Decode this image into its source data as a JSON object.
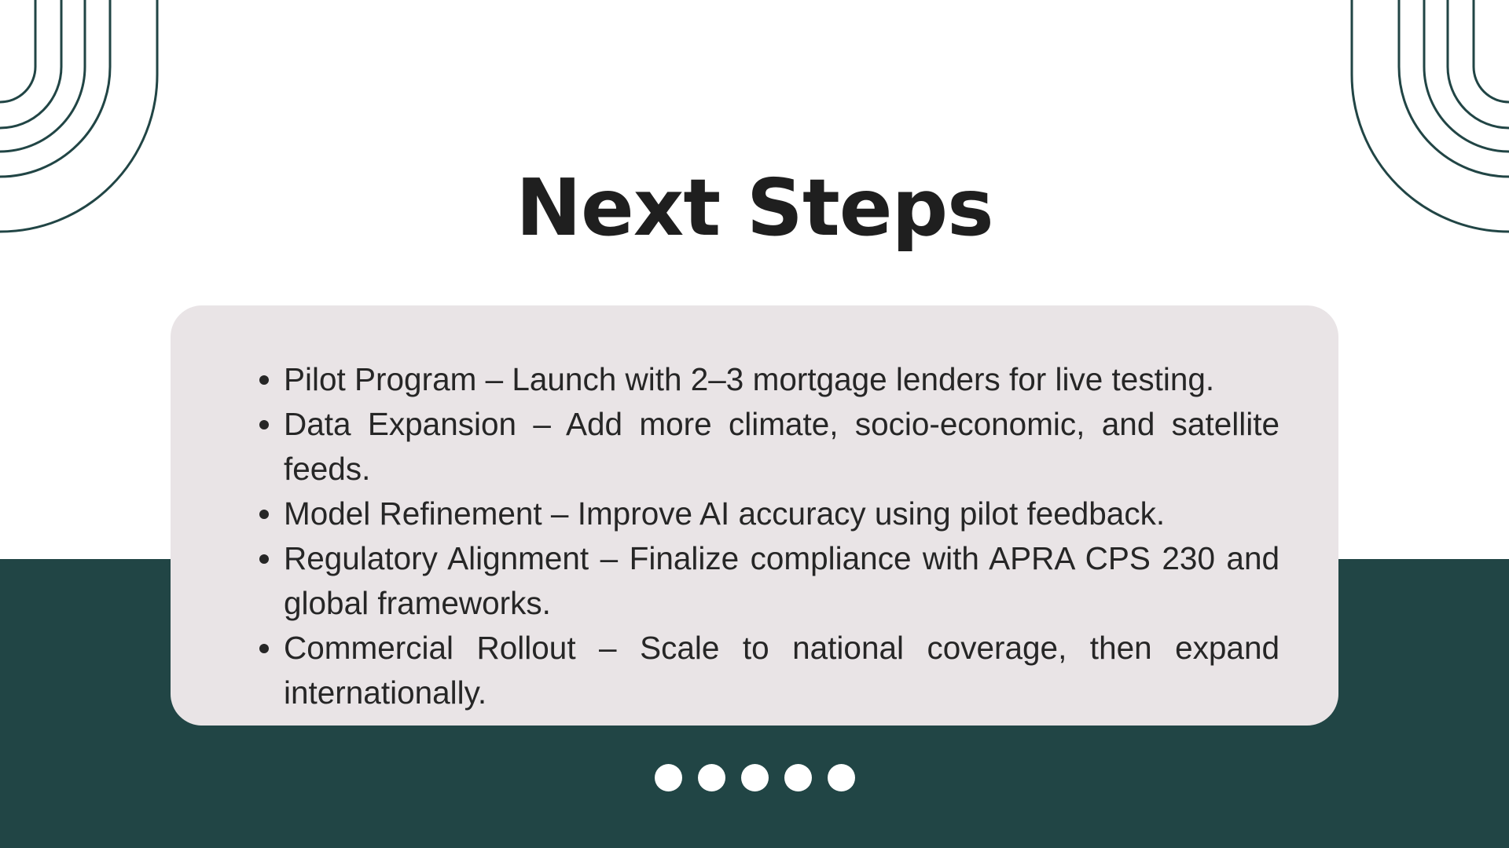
{
  "slide": {
    "title": "Next Steps",
    "steps": [
      {
        "text": "Pilot Program – Launch with 2–3 mortgage lenders for live testing."
      },
      {
        "text": "Data Expansion – Add more climate, socio-economic, and satellite feeds."
      },
      {
        "text": "Model Refinement – Improve AI accuracy using pilot feedback."
      },
      {
        "text": "Regulatory Alignment – Finalize compliance with APRA CPS 230 and global frameworks."
      },
      {
        "text": "Commercial Rollout – Scale to national coverage, then expand internationally."
      }
    ],
    "pagination_dots": 5
  },
  "colors": {
    "accent": "#214545",
    "card": "#e9e4e6",
    "title": "#1f1f1f",
    "text": "#262626",
    "background": "#ffffff"
  },
  "icons": {
    "left_decoration": "concentric-arcs-icon",
    "right_decoration": "concentric-arcs-icon",
    "bullet": "bullet-icon"
  }
}
